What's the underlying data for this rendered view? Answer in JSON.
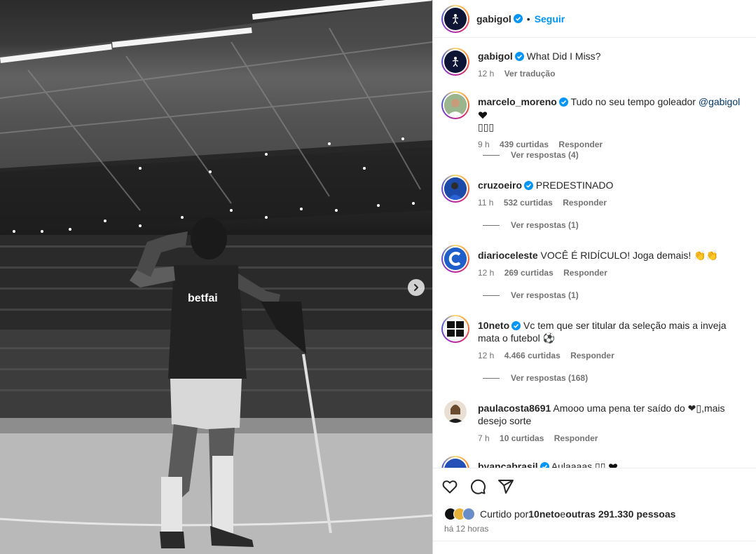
{
  "post": {
    "author": "gabigol",
    "follow_label": "Seguir",
    "separator": "•"
  },
  "caption": {
    "user": "gabigol",
    "text": "What Did I Miss?",
    "time": "12 h",
    "translate_label": "Ver tradução"
  },
  "comments": [
    {
      "user": "marcelo_moreno",
      "text": "Tudo no seu tempo goleador ",
      "mention": "@gabigol",
      "text2": "",
      "second_line": "▯▯▯",
      "time": "9 h",
      "likes": "439 curtidas",
      "reply_label": "Responder",
      "view_replies": "Ver respostas (4)"
    },
    {
      "user": "cruzoeiro",
      "text": "PREDESTINADO",
      "time": "11 h",
      "likes": "532 curtidas",
      "reply_label": "Responder",
      "view_replies": "Ver respostas (1)"
    },
    {
      "user": "diarioceleste",
      "text": "VOCÊ É RIDÍCULO! Joga demais! 👏👏",
      "time": "12 h",
      "likes": "269 curtidas",
      "reply_label": "Responder",
      "view_replies": "Ver respostas (1)"
    },
    {
      "user": "10neto",
      "text": "Vc tem que ser titular da seleção mais a inveja mata o futebol ⚽",
      "time": "12 h",
      "likes": "4.466 curtidas",
      "reply_label": "Responder",
      "view_replies": "Ver respostas (168)"
    },
    {
      "user": "paulacosta8691",
      "text": "Amooo uma pena ter saído do ❤▯,mais desejo sorte",
      "time": "7 h",
      "likes": "10 curtidas",
      "reply_label": "Responder"
    },
    {
      "user": "byancabrasil",
      "text": "Aulaaaas ▯▯"
    }
  ],
  "likes_summary": {
    "prefix": "Curtido por ",
    "user": "10neto",
    "middle": " e ",
    "others": "outras 291.330 pessoas"
  },
  "post_time": "há 12 horas",
  "icons": {
    "like": "heart-icon",
    "comment": "comment-icon",
    "share": "share-icon",
    "verified": "verified-badge-icon",
    "carousel": "chevron-right-icon"
  },
  "colors": {
    "accent": "#0095f6",
    "verified": "#0095f6",
    "muted": "#737373",
    "mention": "#00376b"
  }
}
